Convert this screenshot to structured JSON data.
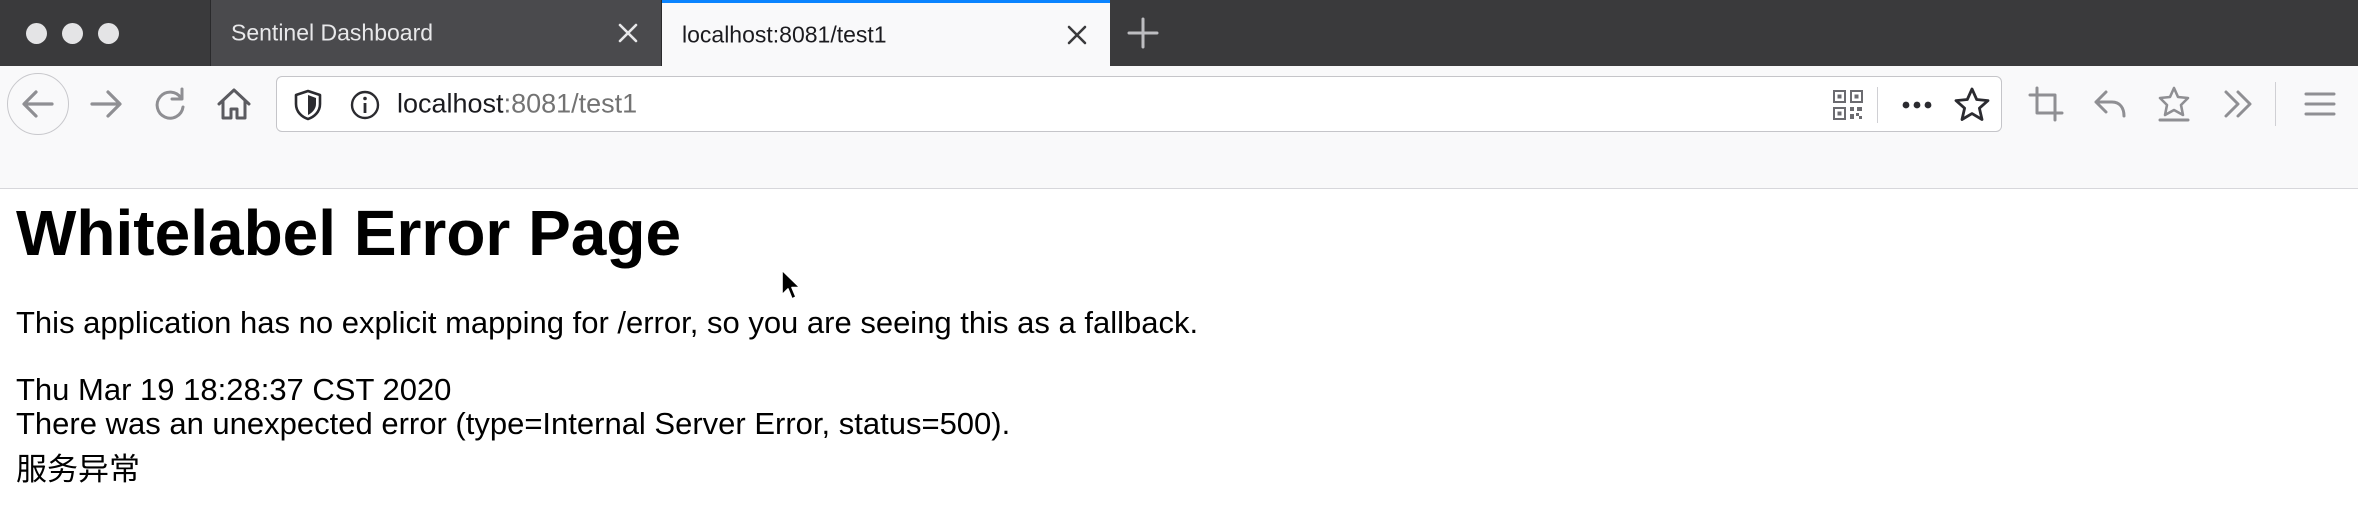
{
  "browser": {
    "tabs": [
      {
        "title": "Sentinel Dashboard",
        "active": false
      },
      {
        "title": "localhost:8081/test1",
        "active": true
      }
    ],
    "address_bar": {
      "host": "localhost",
      "rest": ":8081/test1"
    },
    "icons": {
      "window_controls": [
        "close",
        "minimize",
        "zoom"
      ],
      "toolbar_left": [
        "back-icon",
        "forward-icon",
        "reload-icon",
        "home-icon"
      ],
      "url_bar_left": [
        "tracking-shield-icon",
        "info-icon"
      ],
      "url_bar_right": [
        "qr-code-icon",
        "page-actions-icon",
        "bookmark-star-icon"
      ],
      "toolbar_right": [
        "screenshot-crop-icon",
        "undo-icon",
        "pocket-save-icon",
        "overflow-chevrons-icon",
        "hamburger-menu-icon"
      ]
    },
    "accent_color": "#0a84ff"
  },
  "page": {
    "heading": "Whitelabel Error Page",
    "message": "This application has no explicit mapping for /error, so you are seeing this as a fallback.",
    "timestamp": "Thu Mar 19 18:28:37 CST 2020",
    "error_detail": "There was an unexpected error (type=Internal Server Error, status=500).",
    "error_message": "服务异常"
  }
}
